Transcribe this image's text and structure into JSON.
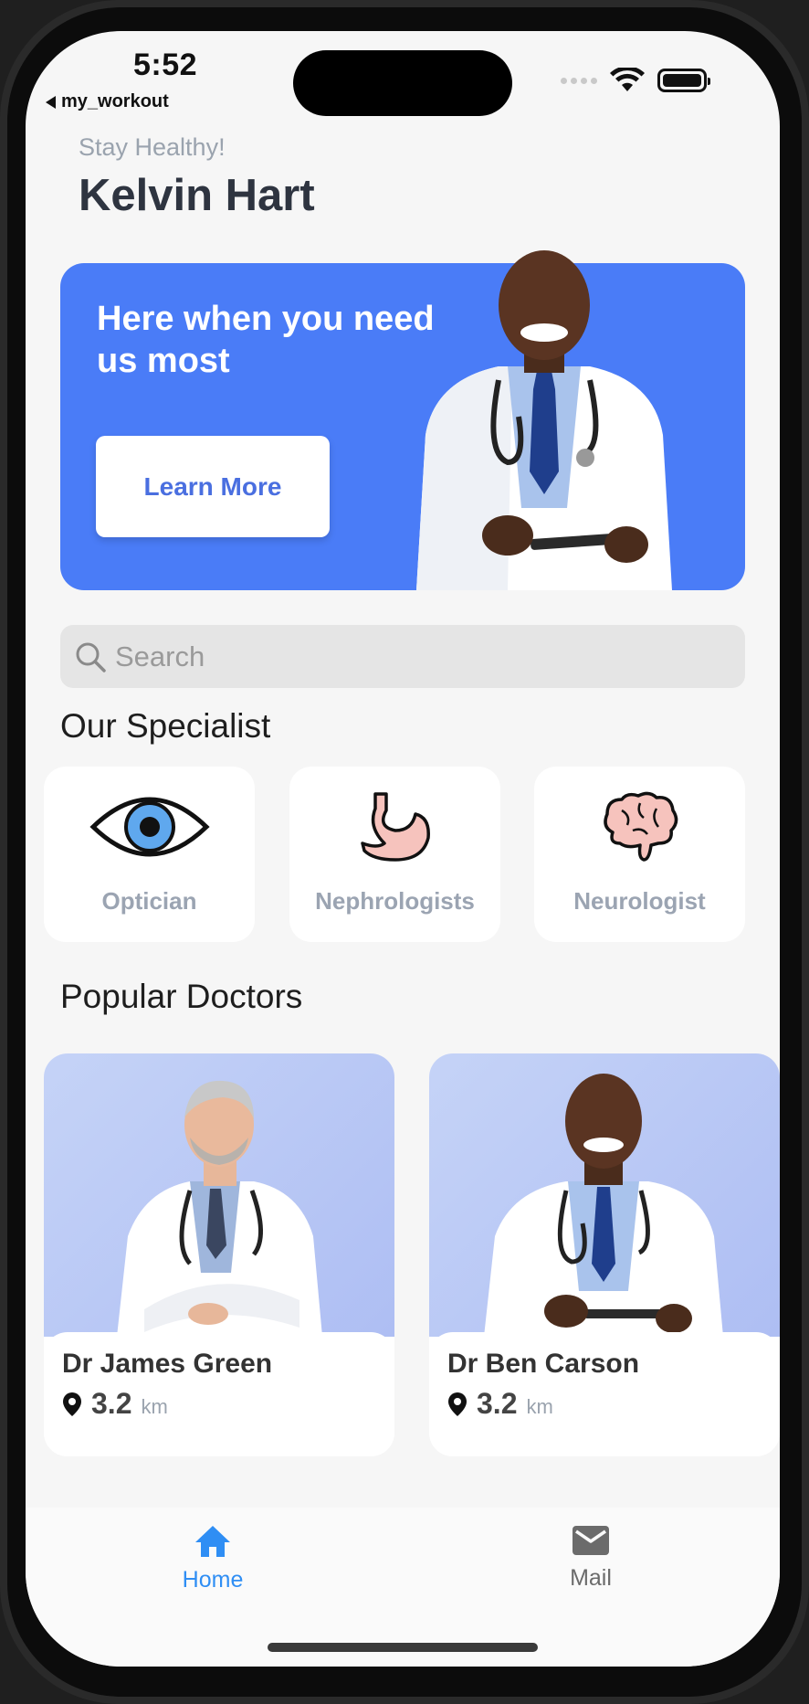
{
  "status_bar": {
    "time": "5:52",
    "back_label": "my_workout"
  },
  "header": {
    "greeting": "Stay Healthy!",
    "user_name": "Kelvin Hart"
  },
  "banner": {
    "title": "Here when you need us most",
    "button_label": "Learn More",
    "background_color": "#4a7cf7"
  },
  "search": {
    "placeholder": "Search",
    "value": ""
  },
  "specialists": {
    "title": "Our Specialist",
    "items": [
      {
        "label": "Optician",
        "icon": "eye-icon"
      },
      {
        "label": "Nephrologists",
        "icon": "stomach-icon"
      },
      {
        "label": "Neurologist",
        "icon": "brain-icon"
      }
    ]
  },
  "doctors": {
    "title": "Popular Doctors",
    "items": [
      {
        "name": "Dr James Green",
        "distance": "3.2",
        "unit": "km"
      },
      {
        "name": "Dr Ben Carson",
        "distance": "3.2",
        "unit": "km"
      }
    ]
  },
  "nav": {
    "items": [
      {
        "label": "Home",
        "icon": "home-icon",
        "active": true
      },
      {
        "label": "Mail",
        "icon": "mail-icon",
        "active": false
      }
    ],
    "active_color": "#2f8ef4",
    "inactive_color": "#6b6b6b"
  }
}
